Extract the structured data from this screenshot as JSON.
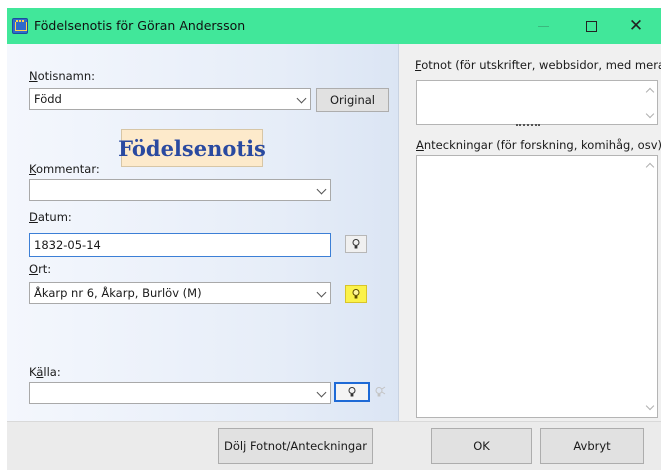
{
  "window": {
    "title": "Födelsenotis för Göran Andersson",
    "accent_color": "#41e79a",
    "icons": {
      "app": "family-tree-app-icon",
      "minimize": "minimize-icon",
      "maximize": "maximize-icon",
      "close": "close-icon"
    },
    "close_glyph": "✕"
  },
  "left": {
    "notisnamn_label": {
      "key": "N",
      "rest": "otisnamn:"
    },
    "notisnamn_value": "Född",
    "original_button": "Original",
    "heading": "Födelsenotis",
    "kommentar_label": {
      "key": "K",
      "rest": "ommentar:"
    },
    "kommentar_value": "",
    "datum_label": {
      "key": "D",
      "rest": "atum:"
    },
    "datum_value": "1832-05-14",
    "ort_label": {
      "key": "O",
      "rest": "rt:"
    },
    "ort_value": "Åkarp nr 6, Åkarp, Burlöv (M)",
    "kalla_label": {
      "pre": "K",
      "key": "ä",
      "rest": "lla:"
    },
    "kalla_value": "",
    "icons": {
      "lightbulb": "lightbulb-icon",
      "dropdown": "chevron-down-icon"
    }
  },
  "right": {
    "fotnot_label": {
      "key": "F",
      "rest": "otnot (för utskrifter, webbsidor, med mera"
    },
    "fotnot_value": "",
    "anteckningar_label": {
      "key": "A",
      "rest": "nteckningar (för forskning, komihåg, osv)"
    },
    "anteckningar_value": ""
  },
  "bottom": {
    "toggle_button": "Dölj Fotnot/Anteckningar",
    "ok_button": "OK",
    "cancel_button": "Avbryt"
  }
}
